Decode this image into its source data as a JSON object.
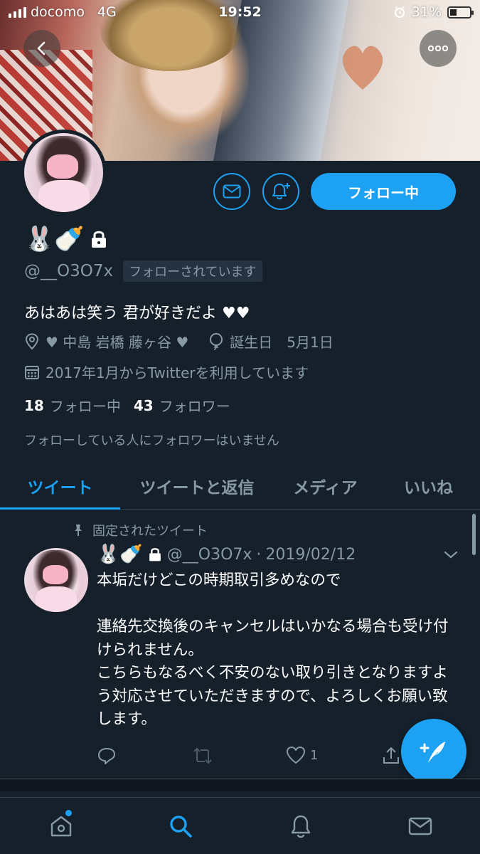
{
  "status_bar": {
    "carrier": "docomo",
    "network": "4G",
    "time": "19:52",
    "battery": "31%"
  },
  "profile": {
    "display_name_emoji": "🐰🍼",
    "handle": "@__O3O7x",
    "follows_you": "フォローされています",
    "follow_button": "フォロー中",
    "bio": "あはあは笑う 君が好きだよ ♥︎♥︎",
    "location": "♥︎ 中島 岩橋 藤ヶ谷 ♥︎",
    "birthday": "誕生日　5月1日",
    "joined": "2017年1月からTwitterを利用しています",
    "following_count": "18",
    "following_label": "フォロー中",
    "followers_count": "43",
    "followers_label": "フォロワー",
    "no_followers_you_know": "フォローしている人にフォロワーはいません"
  },
  "tabs": [
    "ツイート",
    "ツイートと返信",
    "メディア",
    "いいね"
  ],
  "active_tab": "ツイート",
  "pinned_tweet": {
    "pinned_label": "固定されたツイート",
    "name_emoji": "🐰🍼",
    "handle": "@__O3O7x",
    "date": "2019/02/12",
    "text": "本垢だけどこの時期取引多めなので\n\n連絡先交換後のキャンセルはいかなる場合も受け付けられません。\nこちらもなるべく不安のない取り引きとなりますよう対応させていただきますので、よろしくお願い致します。",
    "like_count": "1"
  },
  "colors": {
    "background": "#15202b",
    "accent": "#1da1f2",
    "secondary_text": "#8899a6",
    "divider": "#38444d"
  }
}
